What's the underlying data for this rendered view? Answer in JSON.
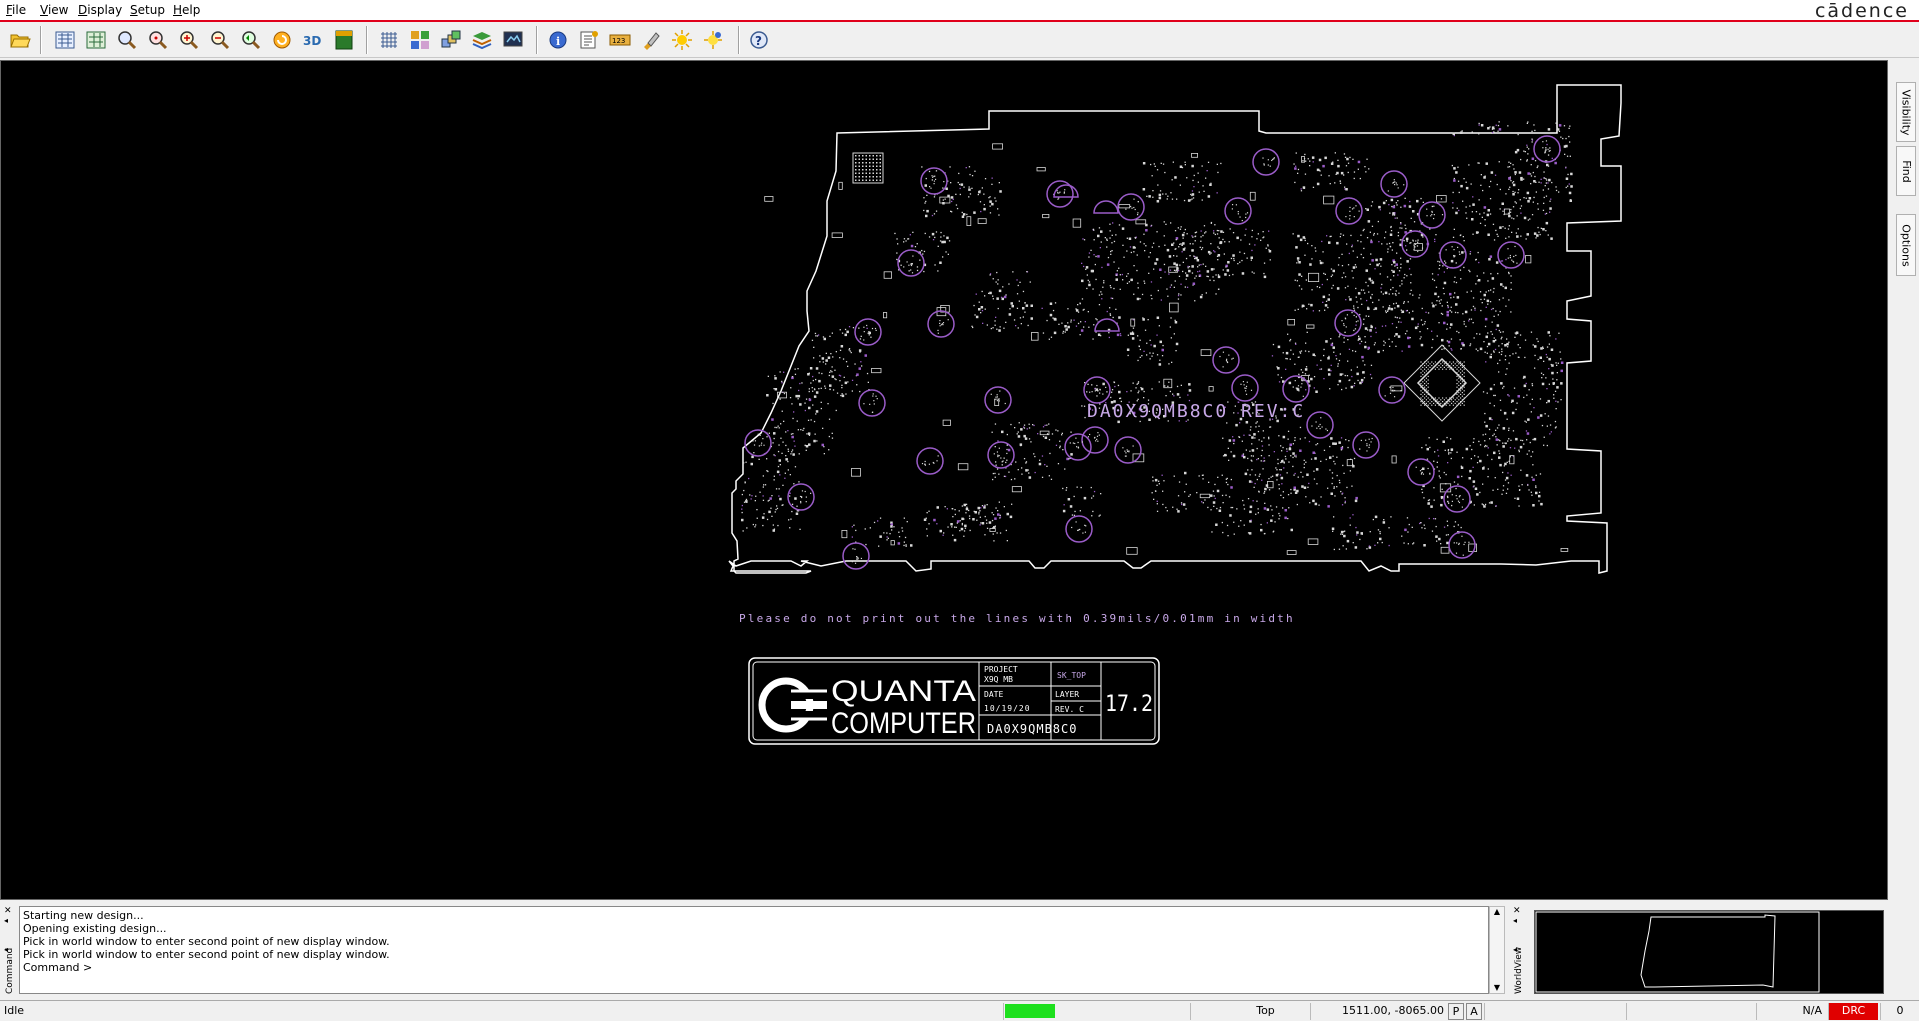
{
  "menu": {
    "items": [
      {
        "label": "File",
        "underline": "F",
        "rest": "ile"
      },
      {
        "label": "View",
        "underline": "V",
        "rest": "iew"
      },
      {
        "label": "Display",
        "underline": "D",
        "rest": "isplay"
      },
      {
        "label": "Setup",
        "underline": "S",
        "rest": "etup"
      },
      {
        "label": "Help",
        "underline": "H",
        "rest": "elp"
      }
    ],
    "brand": "cādence"
  },
  "toolbar": {
    "icons": [
      "open-folder-icon",
      "zoom-fit-icon",
      "zoom-world-icon",
      "zoom-window-icon",
      "zoom-point-icon",
      "zoom-in-icon",
      "zoom-out-icon",
      "zoom-previous-icon",
      "refresh-icon",
      "3d-view-icon",
      "flip-icon",
      "grid-icon",
      "color-icon",
      "layers-icon",
      "stackup-icon",
      "display-icon",
      "info-icon",
      "properties-icon",
      "measure-icon",
      "highlight-icon",
      "dehighlight-icon",
      "shadow-icon",
      "help-icon"
    ]
  },
  "board": {
    "silkscreen_label": "DA0X9QMB8C0  REV:C",
    "note": "Please do not print out the lines with 0.39mils/0.01mm in width",
    "title_block": {
      "company_line1": "QUANTA",
      "company_line2": "COMPUTER",
      "project_label": "PROJECT",
      "project_value": "X9Q MB",
      "sk_label": "SK_TOP",
      "date_label": "DATE",
      "date_value": "10/19/20",
      "layer_label": "LAYER",
      "rev_label": "REV. C",
      "version": "17.2",
      "part_number": "DA0X9QMB8C0"
    },
    "colors": {
      "outline": "#ffffff",
      "silk": "#c8a8e8",
      "pad": "#9a5cc8",
      "dots": "#d8d8d8"
    }
  },
  "side_tabs": [
    "Visibility",
    "Find",
    "Options"
  ],
  "command": {
    "side_label": "Command",
    "lines": [
      "Starting new design...",
      "Opening existing design...",
      "Pick in world window to enter second point of new display window.",
      "Pick in world window to enter second point of new display window.",
      "Command >"
    ]
  },
  "worldview": {
    "side_label": "WorldView"
  },
  "status": {
    "state": "Idle",
    "layer": "Top",
    "coords": "1511.00, -8065.00",
    "p_label": "P",
    "a_label": "A",
    "na": "N/A",
    "drc": "DRC",
    "drc_count": "0",
    "progress_color": "#1ee01e",
    "drc_color": "#e00000"
  }
}
